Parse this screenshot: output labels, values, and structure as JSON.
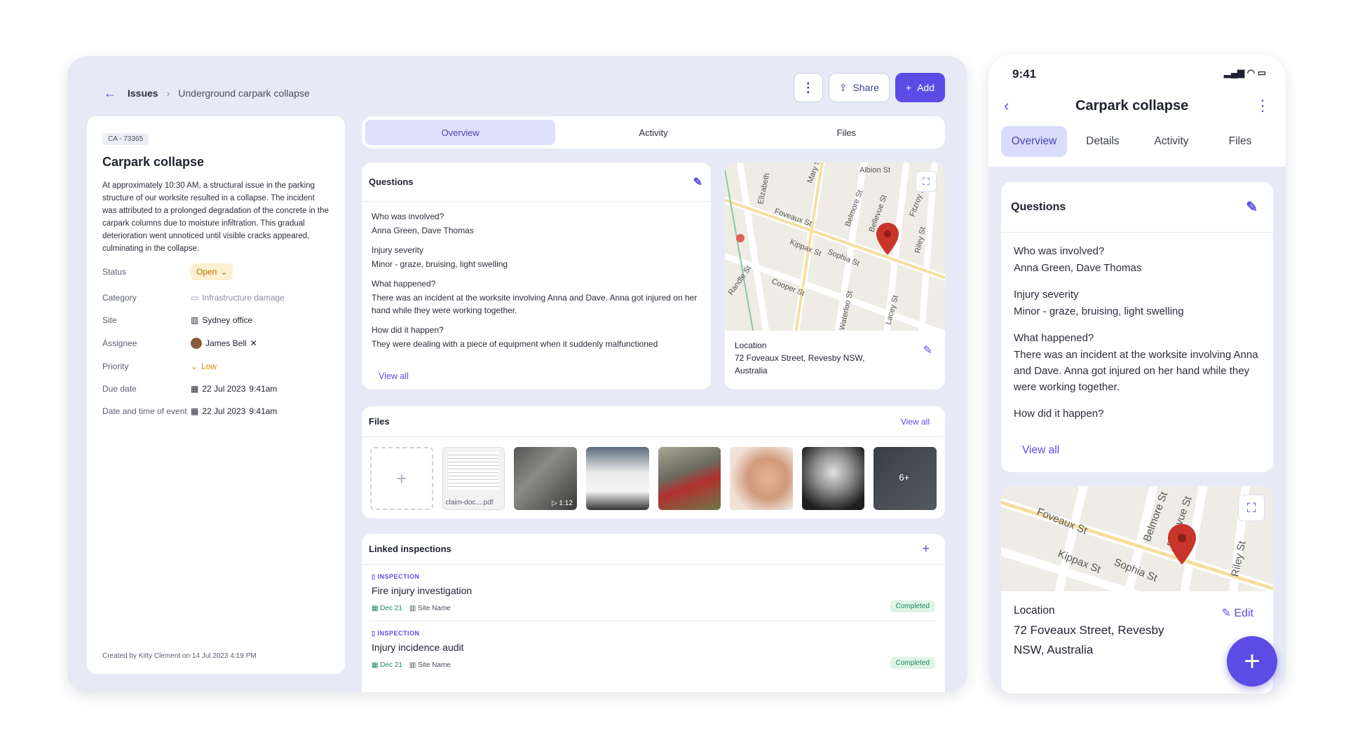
{
  "desktop": {
    "breadcrumb": {
      "back_icon": "arrow-left-icon",
      "parent": "Issues",
      "current": "Underground carpark collapse"
    },
    "actions": {
      "more_icon": "more-vertical-icon",
      "share_label": "Share",
      "add_label": "Add"
    },
    "issue": {
      "id": "CA - 73365",
      "title": "Carpark collapse",
      "description": "At approximately 10:30 AM, a structural issue in the parking structure of our worksite resulted in a collapse. The incident was attributed to a prolonged degradation of the concrete in the carpark columns due to moisture infiltration. This gradual deterioration went unnoticed until visible cracks appeared, culminating in the collapse.",
      "props": {
        "status_k": "Status",
        "status_v": "Open",
        "category_k": "Category",
        "category_v": "Infrastructure damage",
        "site_k": "Site",
        "site_v": "Sydney office",
        "assignee_k": "Assignee",
        "assignee_v": "James Bell",
        "priority_k": "Priority",
        "priority_v": "Low",
        "due_k": "Due date",
        "due_date": "22 Jul 2023",
        "due_time": "9:41am",
        "event_k": "Date and time of event",
        "event_date": "22 Jul 2023",
        "event_time": "9:41am"
      },
      "created": "Created by Kitty Clement on 14 Jul 2023 4:19 PM"
    },
    "tabs": [
      "Overview",
      "Activity",
      "Files"
    ],
    "questions": {
      "title": "Questions",
      "items": [
        {
          "q": "Who was involved?",
          "a": "Anna Green, Dave Thomas"
        },
        {
          "q": "Injury severity",
          "a": "Minor - graze, bruising, light swelling"
        },
        {
          "q": "What happened?",
          "a": "There was an incident at the worksite involving Anna and Dave. Anna got injured on her hand while they were working together."
        },
        {
          "q": "How did it happen?",
          "a": "They were dealing with a piece of equipment when it suddenly malfunctioned"
        }
      ],
      "view_all": "View all"
    },
    "location": {
      "label": "Location",
      "address": "72 Foveaux Street, Revesby NSW, Australia",
      "streets": [
        "Elizabeth",
        "Mary St",
        "Albion St",
        "Foveaux St",
        "Belmore St",
        "Bellevue St",
        "Fitzroy St",
        "Riley St",
        "Kippax St",
        "Sophia St",
        "Randle St",
        "Cooper St",
        "Waterloo St",
        "Lacey St"
      ]
    },
    "files": {
      "title": "Files",
      "view_all": "View all",
      "doc_name": "claim-doc....pdf",
      "video_duration": "1:12",
      "more": "6+"
    },
    "linked": {
      "title": "Linked inspections",
      "items": [
        {
          "label": "INSPECTION",
          "name": "Fire injury investigation",
          "date": "Dec 21",
          "site": "Site Name",
          "status": "Completed"
        },
        {
          "label": "INSPECTION",
          "name": "Injury incidence audit",
          "date": "Dec 21",
          "site": "Site Name",
          "status": "Completed"
        }
      ]
    }
  },
  "phone": {
    "time": "9:41",
    "title": "Carpark collapse",
    "tabs": [
      "Overview",
      "Details",
      "Activity",
      "Files"
    ],
    "questions_title": "Questions",
    "view_all": "View all",
    "location_label": "Location",
    "edit_label": "Edit",
    "address": "72 Foveaux Street, Revesby NSW, Australia"
  },
  "colors": {
    "accent": "#5b4ce6",
    "open": "#b07200",
    "completed": "#1a8a5a"
  }
}
